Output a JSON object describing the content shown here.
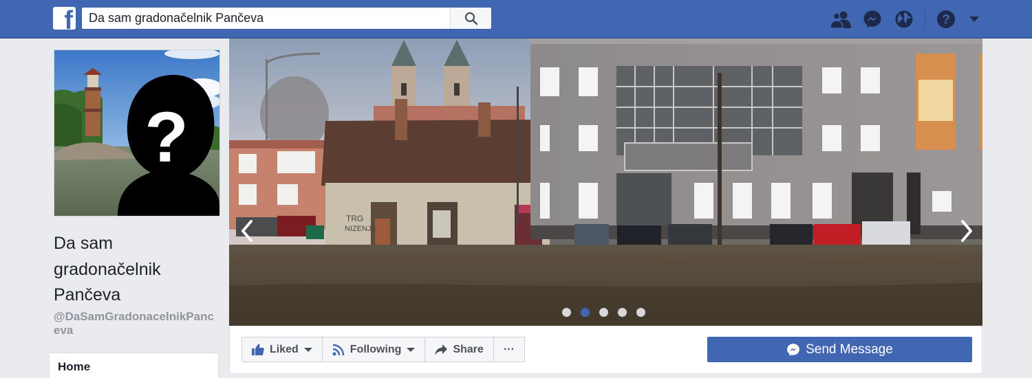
{
  "header": {
    "logo_letter": "f",
    "search": {
      "value": "Da sam gradonačelnik Pančeva",
      "placeholder": ""
    },
    "icons": [
      "friend-requests-icon",
      "messenger-icon",
      "notifications-globe-icon",
      "help-icon",
      "account-dropdown-icon"
    ]
  },
  "page": {
    "name": "Da sam gradonačelnik Pančeva",
    "handle": "@DaSamGradonacelnikPanceva"
  },
  "nav": {
    "home_label": "Home"
  },
  "cover": {
    "slide_count": 5,
    "active_slide": 2
  },
  "actions": {
    "liked_label": "Liked",
    "following_label": "Following",
    "share_label": "Share",
    "more_label": "···",
    "send_message_label": "Send Message"
  },
  "colors": {
    "brand_blue": "#4267b2",
    "background": "#e9ebee"
  }
}
